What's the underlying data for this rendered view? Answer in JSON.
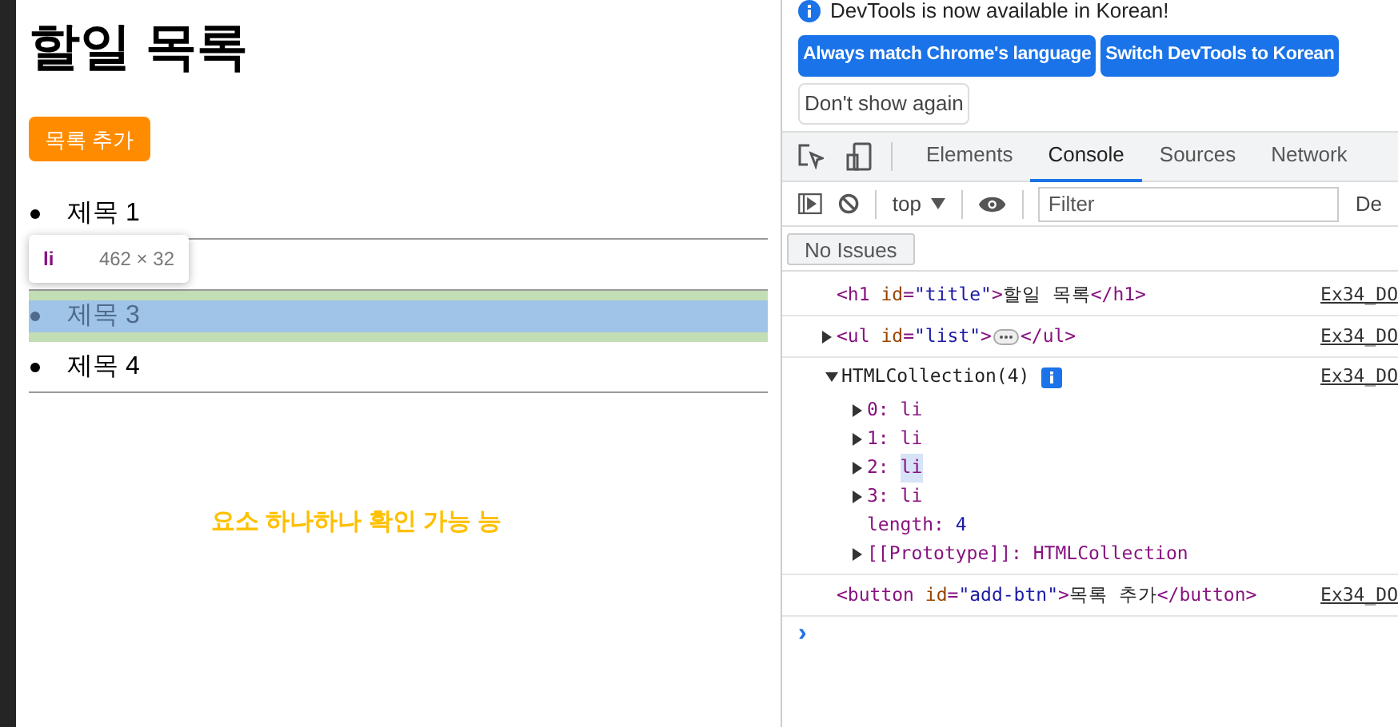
{
  "page": {
    "title": "할일 목록",
    "add_button": "목록 추가",
    "items": [
      {
        "label": "제목 1",
        "highlighted": false
      },
      {
        "highlighted": false
      },
      {
        "label": "제목 3",
        "highlighted": true
      },
      {
        "label": "제목 4",
        "highlighted": false
      }
    ],
    "inspect_tooltip": {
      "tag": "li",
      "size": "462 × 32"
    },
    "caption": "요소 하나하나 확인 가능 능"
  },
  "devtools": {
    "banner": {
      "message": "DevTools is now available in Korean!",
      "buttons": [
        {
          "label": "Always match Chrome's language",
          "kind": "primary"
        },
        {
          "label": "Switch DevTools to Korean",
          "kind": "primary"
        },
        {
          "label": "Don't show again",
          "kind": "secondary"
        }
      ]
    },
    "tabs": [
      {
        "label": "Elements",
        "selected": false
      },
      {
        "label": "Console",
        "selected": true
      },
      {
        "label": "Sources",
        "selected": false
      },
      {
        "label": "Network",
        "selected": false
      }
    ],
    "toolbar": {
      "context": "top",
      "filter_placeholder": "Filter",
      "levels": "De"
    },
    "issues_button": "No Issues",
    "entries": [
      {
        "kind": "element",
        "expandable": false,
        "source": "Ex34_DO",
        "tokens": [
          {
            "kind": "tag",
            "text": "<h1"
          },
          {
            "kind": "attr",
            "text": " id"
          },
          {
            "kind": "tag",
            "text": "="
          },
          {
            "kind": "value",
            "text": "\"title\""
          },
          {
            "kind": "tag",
            "text": ">"
          },
          {
            "kind": "plain",
            "text": "할일 목록"
          },
          {
            "kind": "tag",
            "text": "</h1>"
          }
        ]
      },
      {
        "kind": "element",
        "expandable": true,
        "expanded": false,
        "source": "Ex34_DO",
        "tokens": [
          {
            "kind": "tag",
            "text": "<ul"
          },
          {
            "kind": "attr",
            "text": " id"
          },
          {
            "kind": "tag",
            "text": "="
          },
          {
            "kind": "value",
            "text": "\"list\""
          },
          {
            "kind": "tag",
            "text": ">"
          },
          {
            "kind": "more"
          },
          {
            "kind": "tag",
            "text": "</ul>"
          }
        ]
      },
      {
        "kind": "collection",
        "expanded": true,
        "source": "Ex34_DO",
        "label": "HTMLCollection(4)",
        "children": [
          {
            "key": "0:",
            "value": "li",
            "expandable": true,
            "highlighted": false
          },
          {
            "key": "1:",
            "value": "li",
            "expandable": true,
            "highlighted": false
          },
          {
            "key": "2:",
            "value": "li",
            "expandable": true,
            "highlighted": true
          },
          {
            "key": "3:",
            "value": "li",
            "expandable": true,
            "highlighted": false
          },
          {
            "key": "length:",
            "value": "4",
            "expandable": false,
            "highlighted": false
          },
          {
            "key": "[[Prototype]]:",
            "value": "HTMLCollection",
            "expandable": true,
            "highlighted": false
          }
        ]
      },
      {
        "kind": "element",
        "expandable": false,
        "source": "Ex34_DO",
        "tokens": [
          {
            "kind": "tag",
            "text": "<button"
          },
          {
            "kind": "attr",
            "text": " id"
          },
          {
            "kind": "tag",
            "text": "="
          },
          {
            "kind": "value",
            "text": "\"add-btn\""
          },
          {
            "kind": "tag",
            "text": ">"
          },
          {
            "kind": "plain",
            "text": "목록 추가"
          },
          {
            "kind": "tag",
            "text": "</button>"
          }
        ]
      }
    ],
    "prompt": "›"
  }
}
